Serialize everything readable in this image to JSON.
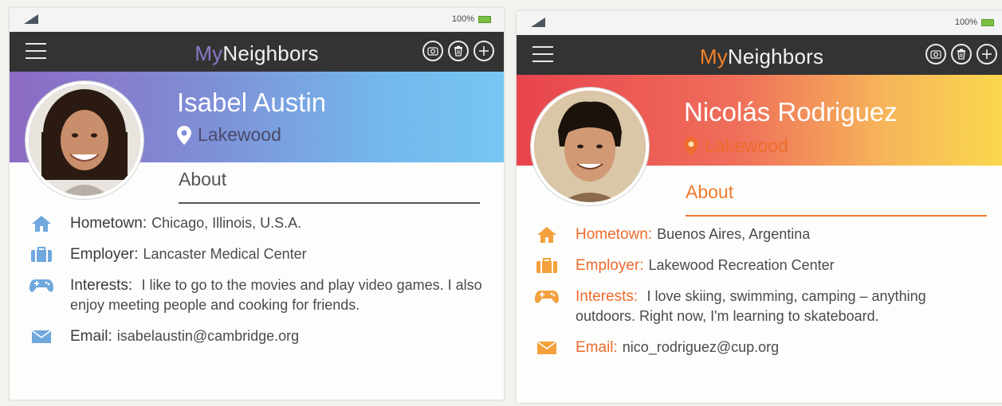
{
  "profiles": [
    {
      "battery": "100%",
      "app_title_prefix": "My",
      "app_title_suffix": "Neighbors",
      "name": "Isabel Austin",
      "location": "Lakewood",
      "section": "About",
      "hometown_label": "Hometown:",
      "hometown": "Chicago, Illinois, U.S.A.",
      "employer_label": "Employer:",
      "employer": "Lancaster Medical Center",
      "interests_label": "Interests:",
      "interests": "I like to go to the movies and play video games. I also enjoy meeting people and cooking for friends.",
      "email_label": "Email:",
      "email": "isabelaustin@cambridge.org",
      "accent": "#7f8fd6",
      "icon_color": "#6fa8dc"
    },
    {
      "battery": "100%",
      "app_title_prefix": "My",
      "app_title_suffix": "Neighbors",
      "name": "Nicolás Rodriguez",
      "location": "Lakewood",
      "section": "About",
      "hometown_label": "Hometown:",
      "hometown": "Buenos Aires, Argentina",
      "employer_label": "Employer:",
      "employer": "Lakewood Recreation Center",
      "interests_label": "Interests:",
      "interests": "I love skiing, swimming, camping – anything outdoors. Right now, I'm learning to skateboard.",
      "email_label": "Email:",
      "email": "nico_rodriguez@cup.org",
      "accent": "#ee6b2d",
      "icon_color": "#f3a13d"
    }
  ],
  "icons": {
    "menu": "menu-icon",
    "camera": "camera-icon",
    "trash": "trash-icon",
    "add": "add-icon",
    "location": "location-pin-icon",
    "home": "home-icon",
    "briefcase": "briefcase-icon",
    "gamepad": "gamepad-icon",
    "email": "envelope-icon"
  }
}
